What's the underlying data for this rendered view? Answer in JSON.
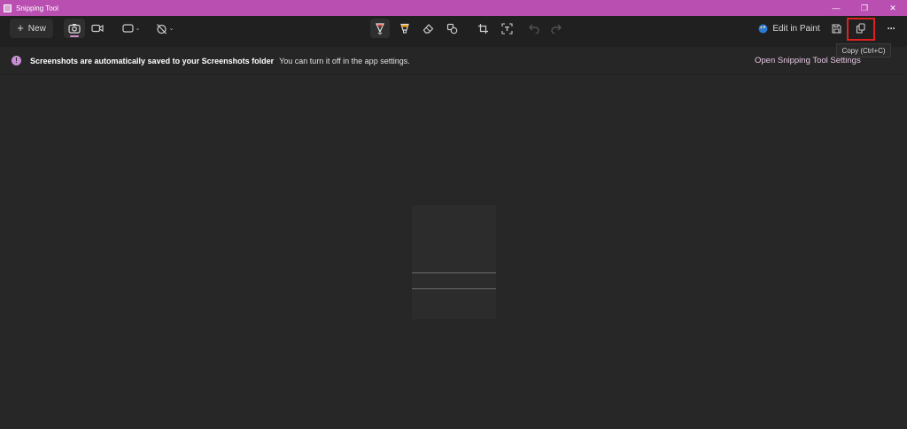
{
  "window": {
    "title": "Snipping Tool",
    "controls": {
      "minimize": "—",
      "restore": "❐",
      "close": "✕"
    }
  },
  "toolbar": {
    "new_label": "New",
    "new_icon": "plus-icon",
    "edit_in_paint_label": "Edit in Paint",
    "more_label": "···",
    "copy_tooltip": "Copy (Ctrl+C)"
  },
  "banner": {
    "bold_text": "Screenshots are automatically saved to your Screenshots folder",
    "text": "You can turn it off in the app settings.",
    "link": "Open Snipping Tool Settings",
    "info_glyph": "!"
  },
  "colors": {
    "titlebar": "#b94fb1",
    "accent": "#d28ac8",
    "highlight": "#e02020",
    "background": "#202020"
  }
}
